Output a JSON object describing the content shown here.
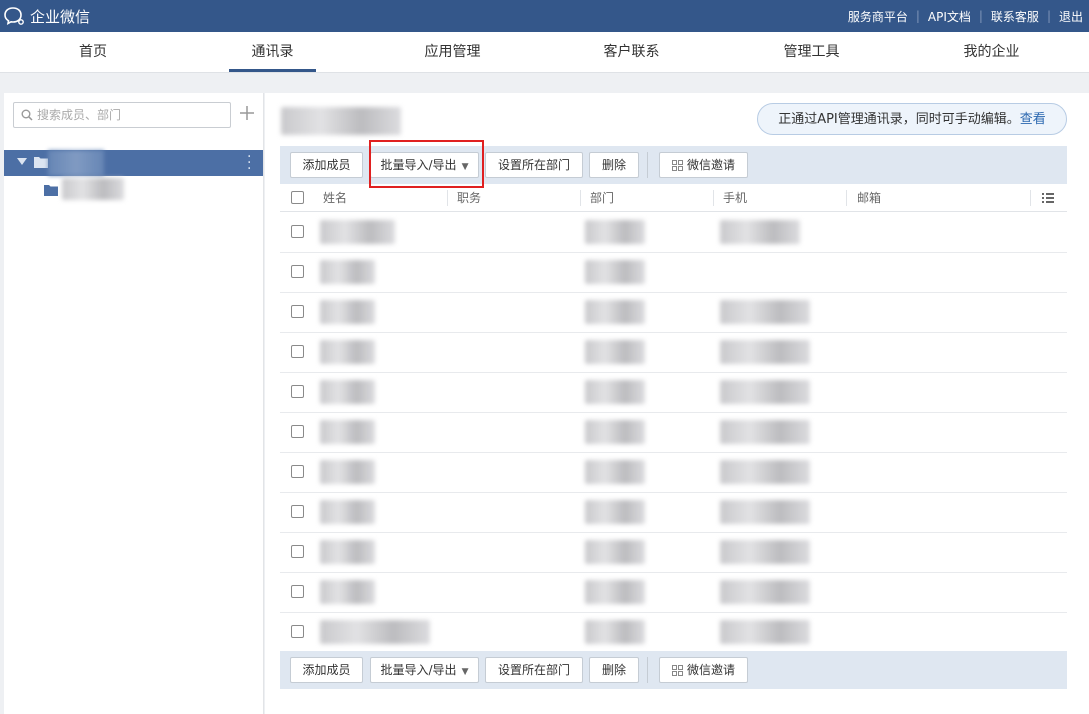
{
  "app": {
    "logo_text": "企业微信",
    "logo_icon": "wework-icon"
  },
  "top_links": [
    "服务商平台",
    "API文档",
    "联系客服",
    "退出"
  ],
  "nav": {
    "tabs": [
      {
        "label": "首页"
      },
      {
        "label": "通讯录",
        "active": true
      },
      {
        "label": "应用管理"
      },
      {
        "label": "客户联系"
      },
      {
        "label": "管理工具"
      },
      {
        "label": "我的企业"
      }
    ]
  },
  "sidebar": {
    "search_placeholder": "搜索成员、部门",
    "add_icon": "plus-icon"
  },
  "notice": {
    "text": "正通过API管理通讯录，同时可手动编辑。",
    "link": "查看"
  },
  "toolbar": {
    "add_member": "添加成员",
    "batch_import_export": "批量导入/导出",
    "set_department": "设置所在部门",
    "delete": "删除",
    "wechat_invite": "微信邀请"
  },
  "table": {
    "columns": [
      "姓名",
      "职务",
      "部门",
      "手机",
      "邮箱"
    ],
    "row_count": 11
  },
  "colors": {
    "topbar": "#34578a",
    "selected_dept": "#4c6fa5",
    "toolbar_bg": "#dfe7f1",
    "highlight": "#e02020",
    "link": "#2c68b0"
  }
}
